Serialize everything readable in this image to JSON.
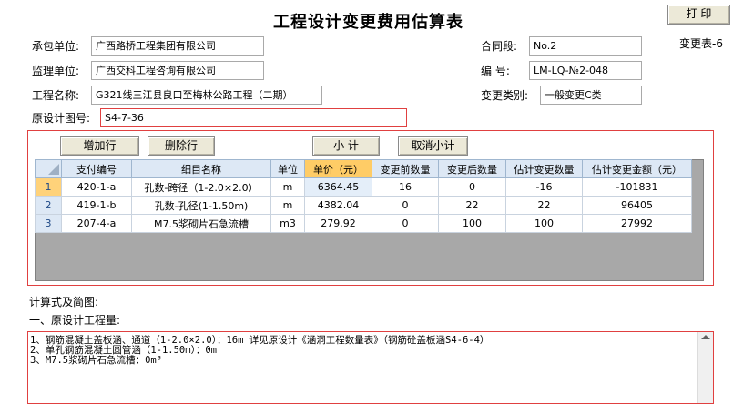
{
  "title": "工程设计变更费用估算表",
  "print_button": "打 印",
  "form_no": "变更表-6",
  "fields": {
    "contractor_label": "承包单位:",
    "contractor_value": "广西路桥工程集团有限公司",
    "supervisor_label": "监理单位:",
    "supervisor_value": "广西交科工程咨询有限公司",
    "project_label": "工程名称:",
    "project_value": "G321线三江县良口至梅林公路工程（二期）",
    "orig_drawing_label": "原设计图号:",
    "orig_drawing_value": "S4-7-36",
    "contract_section_label": "合同段:",
    "contract_section_value": "No.2",
    "number_label": "编   号:",
    "number_value": "LM-LQ-№2-048",
    "change_type_label": "变更类别:",
    "change_type_value": "一般变更C类"
  },
  "toolbar": {
    "add_row": "增加行",
    "delete_row": "删除行",
    "subtotal": "小 计",
    "cancel_subtotal": "取消小计"
  },
  "table": {
    "headers": [
      "支付编号",
      "细目名称",
      "单位",
      "单价（元）",
      "变更前数量",
      "变更后数量",
      "估计变更数量",
      "估计变更金额（元）"
    ],
    "rows": [
      {
        "num": "1",
        "cells": [
          "420-1-a",
          "孔数-跨径（1-2.0×2.0）",
          "m",
          "6364.45",
          "16",
          "0",
          "-16",
          "-101831"
        ]
      },
      {
        "num": "2",
        "cells": [
          "419-1-b",
          "孔数-孔径(1-1.50m)",
          "m",
          "4382.04",
          "0",
          "22",
          "22",
          "96405"
        ]
      },
      {
        "num": "3",
        "cells": [
          "207-4-a",
          "M7.5浆砌片石急流槽",
          "m3",
          "279.92",
          "0",
          "100",
          "100",
          "27992"
        ]
      }
    ]
  },
  "calc": {
    "label": "计算式及简图:",
    "section_label": "一、原设计工程量:",
    "lines": [
      "1、钢筋混凝土盖板涵、通道（1-2.0×2.0）：16m  详见原设计《涵洞工程数量表》（钢筋砼盖板涵S4-6-4）",
      "2、单孔钢筋混凝土圆管涵（1-1.50m）：0m",
      "3、M7.5浆砌片石急流槽：0m³"
    ]
  },
  "colors": {
    "accent_red": "#e04040",
    "header_blue": "#dde8f5",
    "selected_orange": "#ffcc66"
  }
}
